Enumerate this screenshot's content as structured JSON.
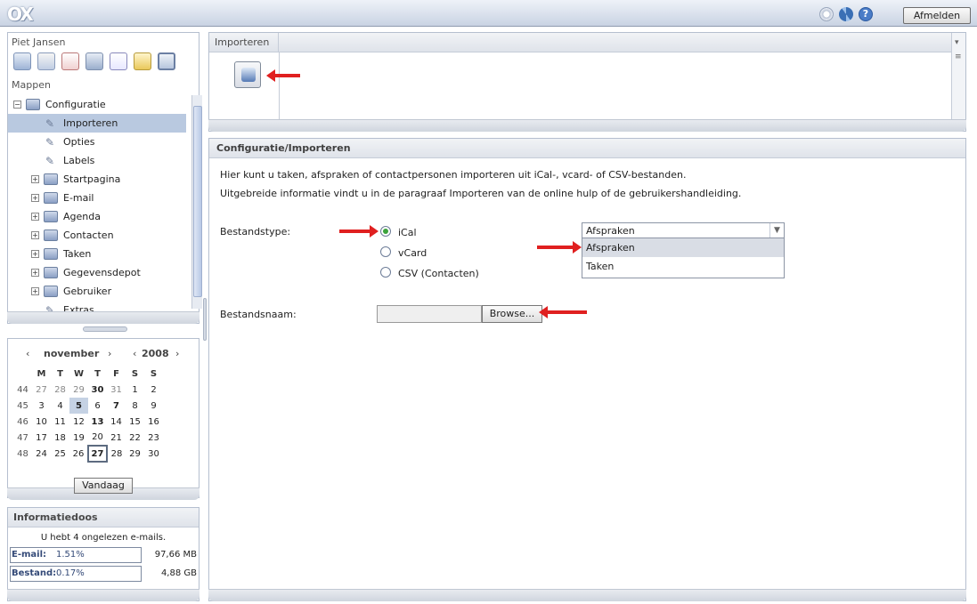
{
  "app": {
    "logo": "OX",
    "logout_label": "Afmelden"
  },
  "left": {
    "user_name": "Piet Jansen",
    "mappen_label": "Mappen",
    "tree": [
      {
        "label": "Configuratie",
        "kind": "folder-open",
        "level": 0
      },
      {
        "label": "Importeren",
        "kind": "tool",
        "level": 1,
        "selected": true
      },
      {
        "label": "Opties",
        "kind": "tool",
        "level": 1
      },
      {
        "label": "Labels",
        "kind": "tool",
        "level": 1
      },
      {
        "label": "Startpagina",
        "kind": "folder",
        "level": 1
      },
      {
        "label": "E-mail",
        "kind": "folder",
        "level": 1
      },
      {
        "label": "Agenda",
        "kind": "folder",
        "level": 1
      },
      {
        "label": "Contacten",
        "kind": "folder",
        "level": 1
      },
      {
        "label": "Taken",
        "kind": "folder",
        "level": 1
      },
      {
        "label": "Gegevensdepot",
        "kind": "folder",
        "level": 1
      },
      {
        "label": "Gebruiker",
        "kind": "folder",
        "level": 1
      },
      {
        "label": "Extras",
        "kind": "tool",
        "level": 1
      }
    ]
  },
  "calendar": {
    "month": "november",
    "year": "2008",
    "weekday_headers": [
      "M",
      "T",
      "W",
      "T",
      "F",
      "S",
      "S"
    ],
    "weeks": [
      {
        "wk": "44",
        "days": [
          "27",
          "28",
          "29",
          "30",
          "31",
          "1",
          "2"
        ]
      },
      {
        "wk": "45",
        "days": [
          "3",
          "4",
          "5",
          "6",
          "7",
          "8",
          "9"
        ]
      },
      {
        "wk": "46",
        "days": [
          "10",
          "11",
          "12",
          "13",
          "14",
          "15",
          "16"
        ]
      },
      {
        "wk": "47",
        "days": [
          "17",
          "18",
          "19",
          "20",
          "21",
          "22",
          "23"
        ]
      },
      {
        "wk": "48",
        "days": [
          "24",
          "25",
          "26",
          "27",
          "28",
          "29",
          "30"
        ]
      }
    ],
    "today_button": "Vandaag"
  },
  "info": {
    "title": "Informatiedoos",
    "message": "U hebt 4 ongelezen e-mails.",
    "email_label": "E-mail:",
    "email_pct": "1.51%",
    "email_quota": "97,66 MB",
    "file_label": "Bestand:",
    "file_pct": "0.17%",
    "file_quota": "4,88 GB"
  },
  "toolbar_panel": {
    "title": "Importeren"
  },
  "main": {
    "title": "Configuratie/Importeren",
    "intro_1": "Hier kunt u taken, afspraken of contactpersonen importeren uit iCal-, vcard- of CSV-bestanden.",
    "intro_2": "Uitgebreide informatie vindt u in de paragraaf Importeren van de online hulp of de gebruikershandleiding.",
    "filetype_label": "Bestandstype:",
    "options": [
      "iCal",
      "vCard",
      "CSV (Contacten)"
    ],
    "selected_option": "iCal",
    "dropdown_value": "Afspraken",
    "dropdown_options": [
      "Afspraken",
      "Taken"
    ],
    "filename_label": "Bestandsnaam:",
    "browse_label": "Browse..."
  },
  "colors": {
    "accent": "#b9c9e0",
    "arrow": "#e02020",
    "radio_on": "#3ca33c"
  }
}
